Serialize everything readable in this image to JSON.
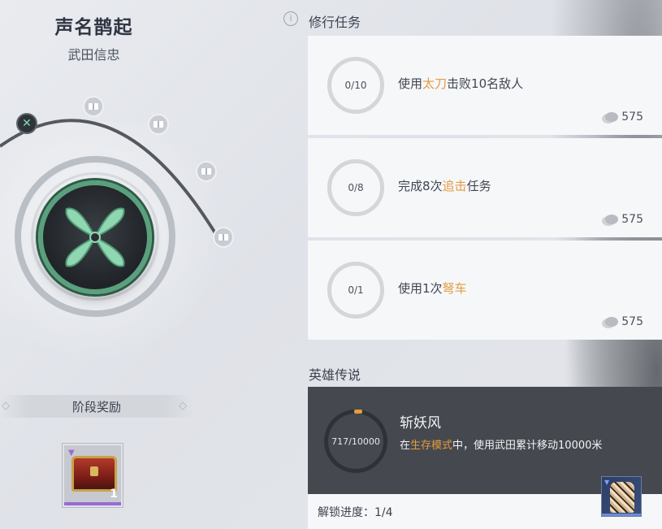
{
  "left": {
    "title": "声名鹊起",
    "subtitle": "武田信忠",
    "stage_reward_label": "阶段奖励",
    "reward_quantity": "1"
  },
  "tasks_section": {
    "title": "修行任务"
  },
  "tasks": [
    {
      "progress": "0/10",
      "desc_pre": "使用",
      "desc_hl": "太刀",
      "desc_post": "击败10名敌人",
      "points": "575"
    },
    {
      "progress": "0/8",
      "desc_pre": "完成8次",
      "desc_hl": "追击",
      "desc_post": "任务",
      "points": "575"
    },
    {
      "progress": "0/1",
      "desc_pre": "使用1次",
      "desc_hl": "弩车",
      "desc_post": "",
      "points": "575"
    }
  ],
  "hero_section": {
    "title": "英雄传说"
  },
  "hero": {
    "progress": "717/10000",
    "title": "斩妖风",
    "desc_pre": "在",
    "desc_hl": "生存模式",
    "desc_post": "中，使用武田累计移动10000米",
    "unlock_progress": "解锁进度：1/4"
  },
  "colors": {
    "highlight": "#e39c3f",
    "emblem_green": "#5aa07e",
    "hero_card": "#45494f"
  }
}
